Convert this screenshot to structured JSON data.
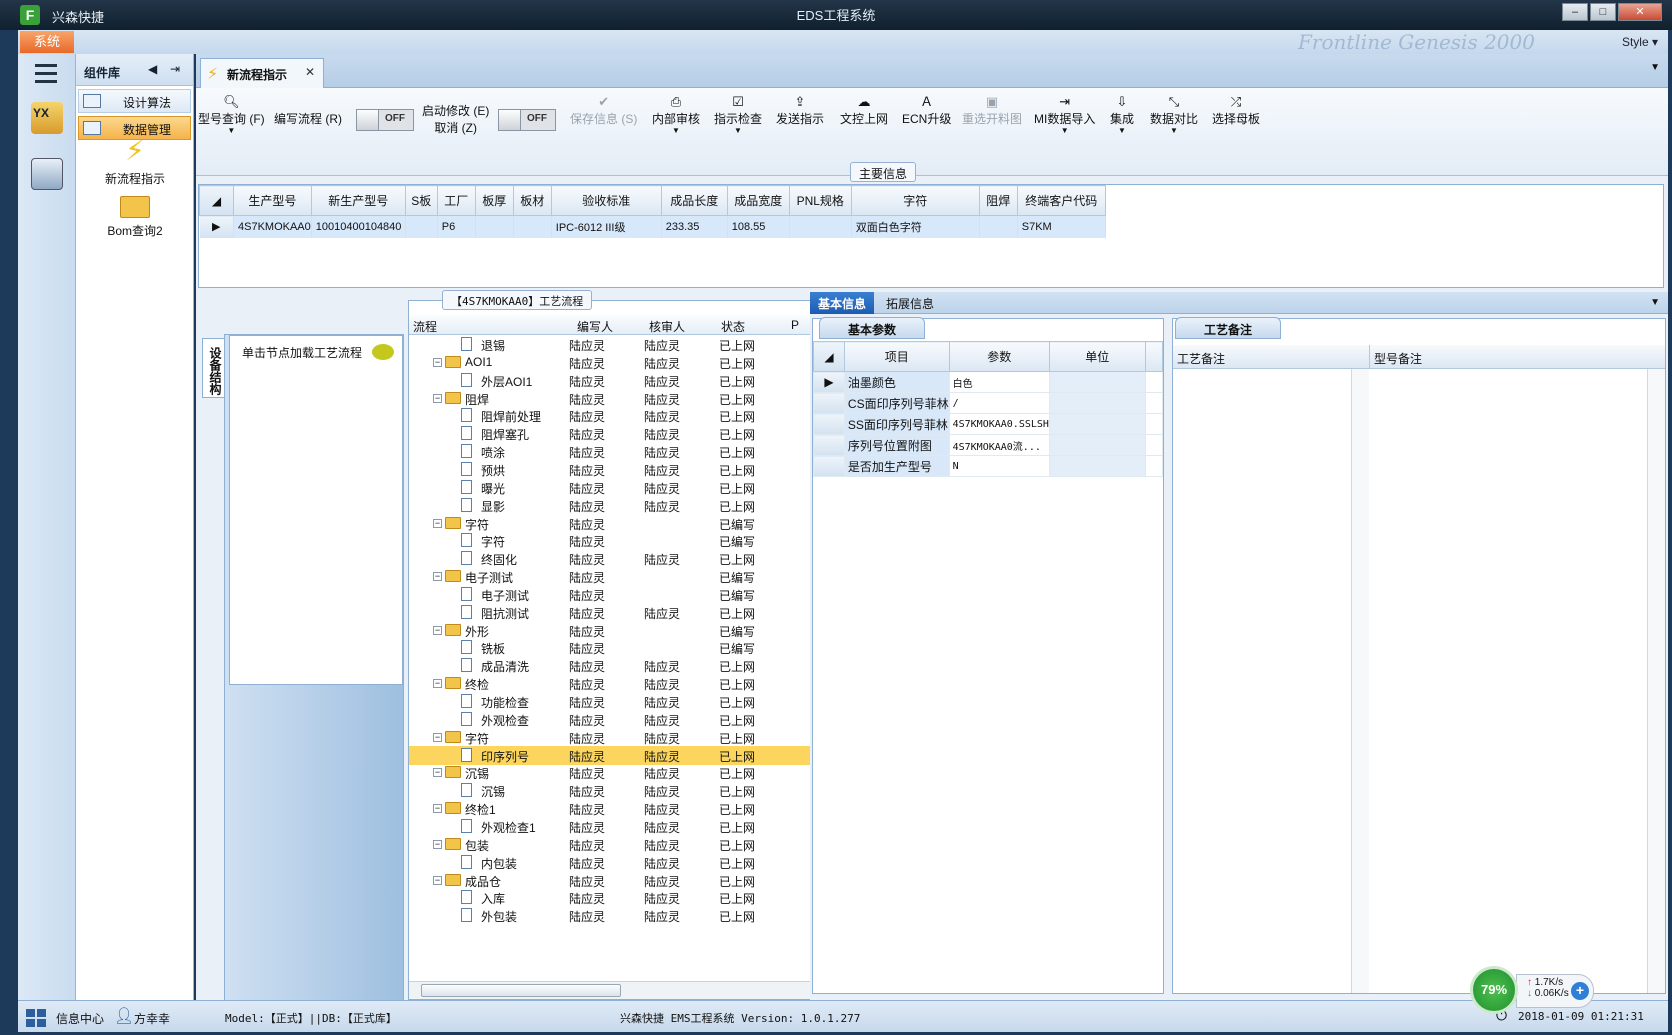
{
  "window": {
    "app_short": "F",
    "app_name": "兴森快捷",
    "title": "EDS工程系统",
    "style_label": "Style ▾",
    "menu_watermark": "Frontline  Genesis 2000"
  },
  "menu": {
    "system": "系统"
  },
  "complib": {
    "title": "组件库",
    "items": [
      "设计算法",
      "数据管理"
    ],
    "tiles": [
      "新流程指示",
      "Bom查询2"
    ]
  },
  "doc_tab": {
    "title": "新流程指示"
  },
  "toolbar": {
    "model_query": "型号查询 (F)",
    "edit_flow": "编写流程 (R)",
    "toggle_off": "OFF",
    "start_modify": "启动修改 (E)",
    "cancel": "取消 (Z)",
    "save_info": "保存信息 (S)",
    "internal_review": "内部审核",
    "instruction_check": "指示检查",
    "send_instruction": "发送指示",
    "doc_upload": "文控上网",
    "ecn_upgrade": "ECN升级",
    "refresh_cutting": "重选开料图",
    "mi_import": "MI数据导入",
    "integrate": "集成",
    "data_compare": "数据对比",
    "select_master": "选择母板"
  },
  "main_info": {
    "title": "主要信息",
    "columns": [
      "生产型号",
      "新生产型号",
      "S板",
      "工厂",
      "板厚",
      "板材",
      "验收标准",
      "成品长度",
      "成品宽度",
      "PNL规格",
      "字符",
      "阻焊",
      "终端客户代码"
    ],
    "rows": [
      [
        "4S7KMOKAA0",
        "10010400104840",
        "",
        "P6",
        "",
        "",
        "IPC-6012 III级",
        "233.35",
        "108.55",
        "",
        "双面白色字符",
        "",
        "S7KM"
      ]
    ]
  },
  "equipment": {
    "tab_label": "设备结构",
    "hint": "单击节点加载工艺流程"
  },
  "process": {
    "title": "【4S7KMOKAA0】工艺流程",
    "headers": [
      "流程",
      "编写人",
      "核审人",
      "状态",
      "P"
    ],
    "rows": [
      {
        "level": 2,
        "type": "doc",
        "name": "退锡",
        "writer": "陆应灵",
        "reviewer": "陆应灵",
        "status": "已上网"
      },
      {
        "level": 1,
        "type": "folder",
        "name": "AOI1",
        "writer": "陆应灵",
        "reviewer": "陆应灵",
        "status": "已上网"
      },
      {
        "level": 2,
        "type": "doc",
        "name": "外层AOI1",
        "writer": "陆应灵",
        "reviewer": "陆应灵",
        "status": "已上网"
      },
      {
        "level": 1,
        "type": "folder",
        "name": "阻焊",
        "writer": "陆应灵",
        "reviewer": "陆应灵",
        "status": "已上网"
      },
      {
        "level": 2,
        "type": "doc",
        "name": "阻焊前处理",
        "writer": "陆应灵",
        "reviewer": "陆应灵",
        "status": "已上网"
      },
      {
        "level": 2,
        "type": "doc",
        "name": "阻焊塞孔",
        "writer": "陆应灵",
        "reviewer": "陆应灵",
        "status": "已上网"
      },
      {
        "level": 2,
        "type": "doc",
        "name": "喷涂",
        "writer": "陆应灵",
        "reviewer": "陆应灵",
        "status": "已上网"
      },
      {
        "level": 2,
        "type": "doc",
        "name": "预烘",
        "writer": "陆应灵",
        "reviewer": "陆应灵",
        "status": "已上网"
      },
      {
        "level": 2,
        "type": "doc",
        "name": "曝光",
        "writer": "陆应灵",
        "reviewer": "陆应灵",
        "status": "已上网"
      },
      {
        "level": 2,
        "type": "doc",
        "name": "显影",
        "writer": "陆应灵",
        "reviewer": "陆应灵",
        "status": "已上网"
      },
      {
        "level": 1,
        "type": "folder",
        "name": "字符",
        "writer": "陆应灵",
        "reviewer": "",
        "status": "已编写"
      },
      {
        "level": 2,
        "type": "doc",
        "name": "字符",
        "writer": "陆应灵",
        "reviewer": "",
        "status": "已编写"
      },
      {
        "level": 2,
        "type": "doc",
        "name": "终固化",
        "writer": "陆应灵",
        "reviewer": "陆应灵",
        "status": "已上网"
      },
      {
        "level": 1,
        "type": "folder",
        "name": "电子测试",
        "writer": "陆应灵",
        "reviewer": "",
        "status": "已编写"
      },
      {
        "level": 2,
        "type": "doc",
        "name": "电子测试",
        "writer": "陆应灵",
        "reviewer": "",
        "status": "已编写"
      },
      {
        "level": 2,
        "type": "doc",
        "name": "阻抗测试",
        "writer": "陆应灵",
        "reviewer": "陆应灵",
        "status": "已上网"
      },
      {
        "level": 1,
        "type": "folder",
        "name": "外形",
        "writer": "陆应灵",
        "reviewer": "",
        "status": "已编写"
      },
      {
        "level": 2,
        "type": "doc",
        "name": "铣板",
        "writer": "陆应灵",
        "reviewer": "",
        "status": "已编写"
      },
      {
        "level": 2,
        "type": "doc",
        "name": "成品清洗",
        "writer": "陆应灵",
        "reviewer": "陆应灵",
        "status": "已上网"
      },
      {
        "level": 1,
        "type": "folder",
        "name": "终检",
        "writer": "陆应灵",
        "reviewer": "陆应灵",
        "status": "已上网"
      },
      {
        "level": 2,
        "type": "doc",
        "name": "功能检查",
        "writer": "陆应灵",
        "reviewer": "陆应灵",
        "status": "已上网"
      },
      {
        "level": 2,
        "type": "doc",
        "name": "外观检查",
        "writer": "陆应灵",
        "reviewer": "陆应灵",
        "status": "已上网"
      },
      {
        "level": 1,
        "type": "folder",
        "name": "字符",
        "writer": "陆应灵",
        "reviewer": "陆应灵",
        "status": "已上网"
      },
      {
        "level": 2,
        "type": "doc",
        "name": "印序列号",
        "writer": "陆应灵",
        "reviewer": "陆应灵",
        "status": "已上网",
        "selected": true
      },
      {
        "level": 1,
        "type": "folder",
        "name": "沉锡",
        "writer": "陆应灵",
        "reviewer": "陆应灵",
        "status": "已上网"
      },
      {
        "level": 2,
        "type": "doc",
        "name": "沉锡",
        "writer": "陆应灵",
        "reviewer": "陆应灵",
        "status": "已上网"
      },
      {
        "level": 1,
        "type": "folder",
        "name": "终检1",
        "writer": "陆应灵",
        "reviewer": "陆应灵",
        "status": "已上网"
      },
      {
        "level": 2,
        "type": "doc",
        "name": "外观检查1",
        "writer": "陆应灵",
        "reviewer": "陆应灵",
        "status": "已上网"
      },
      {
        "level": 1,
        "type": "folder",
        "name": "包装",
        "writer": "陆应灵",
        "reviewer": "陆应灵",
        "status": "已上网"
      },
      {
        "level": 2,
        "type": "doc",
        "name": "内包装",
        "writer": "陆应灵",
        "reviewer": "陆应灵",
        "status": "已上网"
      },
      {
        "level": 1,
        "type": "folder",
        "name": "成品仓",
        "writer": "陆应灵",
        "reviewer": "陆应灵",
        "status": "已上网"
      },
      {
        "level": 2,
        "type": "doc",
        "name": "入库",
        "writer": "陆应灵",
        "reviewer": "陆应灵",
        "status": "已上网"
      },
      {
        "level": 2,
        "type": "doc",
        "name": "外包装",
        "writer": "陆应灵",
        "reviewer": "陆应灵",
        "status": "已上网"
      }
    ]
  },
  "detail": {
    "tabs": [
      "基本信息",
      "拓展信息"
    ],
    "basic_params": {
      "tab": "基本参数",
      "headers": [
        "项目",
        "参数",
        "单位"
      ],
      "rows": [
        {
          "item": "油墨颜色",
          "param": "白色",
          "unit": ""
        },
        {
          "item": "CS面印序列号菲林",
          "param": "/",
          "unit": ""
        },
        {
          "item": "SS面印序列号菲林",
          "param": "4S7KMOKAA0.SSLSH",
          "unit": ""
        },
        {
          "item": "序列号位置附图",
          "param": "4S7KMOKAA0流...",
          "unit": ""
        },
        {
          "item": "是否加生产型号",
          "param": "N",
          "unit": ""
        }
      ]
    },
    "remarks": {
      "tab": "工艺备注",
      "process_remark": "工艺备注",
      "model_remark": "型号备注"
    }
  },
  "statusbar": {
    "info_center": "信息中心",
    "user": "方幸幸",
    "model_db": "Model:【正式】||DB:【正式库】",
    "version": "兴森快捷 EMS工程系统 Version: 1.0.1.277",
    "datetime": "2018-01-09 01:21:31"
  },
  "network": {
    "percent": "79%",
    "up": "1.7K/s",
    "down": "0.06K/s"
  }
}
